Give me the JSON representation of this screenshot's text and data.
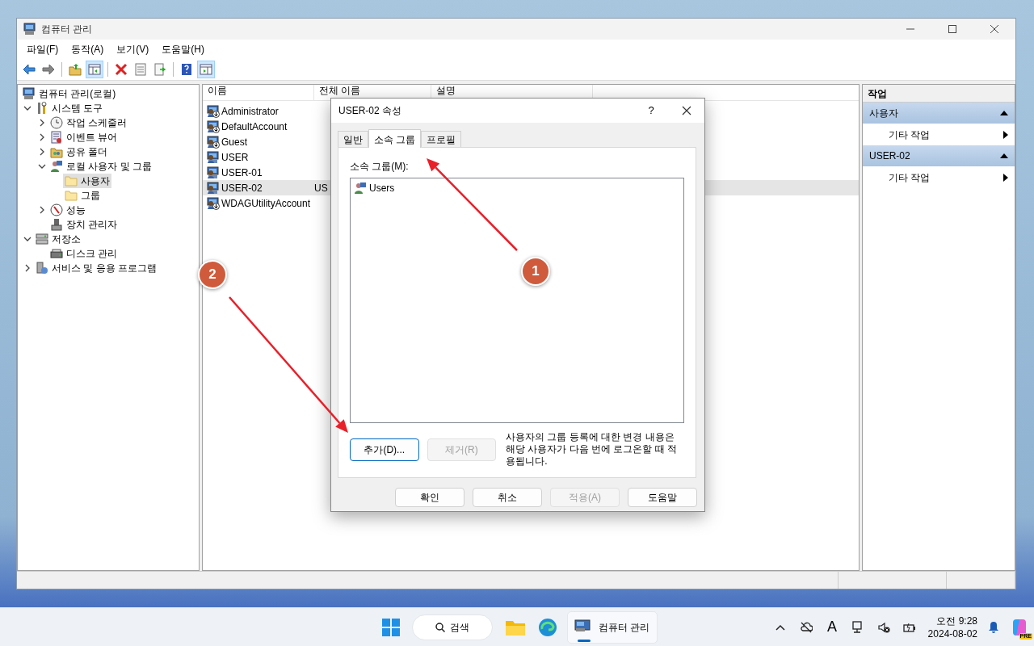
{
  "window": {
    "title": "컴퓨터 관리"
  },
  "menu": [
    "파일(F)",
    "동작(A)",
    "보기(V)",
    "도움말(H)"
  ],
  "toolbar": [
    {
      "kind": "back",
      "pressed": false
    },
    {
      "kind": "forward",
      "pressed": false
    },
    {
      "kind": "separator"
    },
    {
      "kind": "up",
      "pressed": false
    },
    {
      "kind": "tree",
      "pressed": true
    },
    {
      "kind": "separator"
    },
    {
      "kind": "delete",
      "pressed": false
    },
    {
      "kind": "properties",
      "pressed": false
    },
    {
      "kind": "export",
      "pressed": false
    },
    {
      "kind": "separator"
    },
    {
      "kind": "help",
      "pressed": false
    },
    {
      "kind": "pane",
      "pressed": true
    }
  ],
  "tree": [
    {
      "label": "컴퓨터 관리(로컬)",
      "kind": "computer",
      "selected": false,
      "children": [
        {
          "label": "시스템 도구",
          "kind": "tools",
          "selected": false,
          "expanded": true,
          "children": [
            {
              "label": "작업 스케줄러",
              "kind": "clock",
              "selected": false,
              "expanded": false
            },
            {
              "label": "이벤트 뷰어",
              "kind": "event",
              "selected": false,
              "expanded": false
            },
            {
              "label": "공유 폴더",
              "kind": "share",
              "selected": false,
              "expanded": false
            },
            {
              "label": "로컬 사용자 및 그룹",
              "kind": "users",
              "selected": false,
              "expanded": true,
              "children": [
                {
                  "label": "사용자",
                  "kind": "folder",
                  "selected": true
                },
                {
                  "label": "그룹",
                  "kind": "folder",
                  "selected": false
                }
              ]
            },
            {
              "label": "성능",
              "kind": "perf",
              "selected": false,
              "expanded": false
            },
            {
              "label": "장치 관리자",
              "kind": "device",
              "selected": false
            }
          ]
        },
        {
          "label": "저장소",
          "kind": "storage",
          "selected": false,
          "expanded": true,
          "children": [
            {
              "label": "디스크 관리",
              "kind": "disk",
              "selected": false
            }
          ]
        },
        {
          "label": "서비스 및 응용 프로그램",
          "kind": "services",
          "selected": false,
          "expanded": false
        }
      ]
    }
  ],
  "list": {
    "columns": [
      "이름",
      "전체 이름",
      "설명"
    ],
    "rows": [
      {
        "name": "Administrator",
        "disabled": true,
        "selected": false
      },
      {
        "name": "DefaultAccount",
        "disabled": true,
        "selected": false
      },
      {
        "name": "Guest",
        "disabled": true,
        "selected": false
      },
      {
        "name": "USER",
        "disabled": false,
        "selected": false
      },
      {
        "name": "USER-01",
        "disabled": false,
        "selected": false
      },
      {
        "name": "USER-02",
        "full_name": "US",
        "disabled": false,
        "selected": true
      },
      {
        "name": "WDAGUtilityAccount",
        "disabled": true,
        "selected": false
      }
    ]
  },
  "actions": {
    "title": "작업",
    "sections": [
      {
        "label": "사용자",
        "expanded": true,
        "items": [
          "기타 작업"
        ]
      },
      {
        "label": "USER-02",
        "expanded": true,
        "items": [
          "기타 작업"
        ]
      }
    ]
  },
  "dialog": {
    "title": "USER-02 속성",
    "help": "?",
    "tabs": [
      {
        "label": "일반",
        "selected": false
      },
      {
        "label": "소속 그룹",
        "selected": true
      },
      {
        "label": "프로필",
        "selected": false
      }
    ],
    "group_label": "소속 그룹(M):",
    "groups": [
      {
        "label": "Users",
        "selected": false
      }
    ],
    "group_buttons": [
      {
        "label": "추가(D)...",
        "disabled": false,
        "focused": true
      },
      {
        "label": "제거(R)",
        "disabled": true,
        "focused": false
      }
    ],
    "note": "사용자의 그룹 등록에 대한 변경 내용은 해당 사용자가 다음 번에 로그온할 때 적용됩니다.",
    "buttons": [
      {
        "label": "확인",
        "disabled": false
      },
      {
        "label": "취소",
        "disabled": false
      },
      {
        "label": "적용(A)",
        "disabled": true
      },
      {
        "label": "도움말",
        "disabled": false
      }
    ]
  },
  "annotations": [
    {
      "number": "2"
    },
    {
      "number": "1"
    }
  ],
  "taskbar": {
    "search": "검색",
    "app": {
      "label": "컴퓨터 관리",
      "active": true
    },
    "ime": "A",
    "time": "오전 9:28",
    "date": "2024-08-02",
    "copilot_badge": "PRE"
  }
}
